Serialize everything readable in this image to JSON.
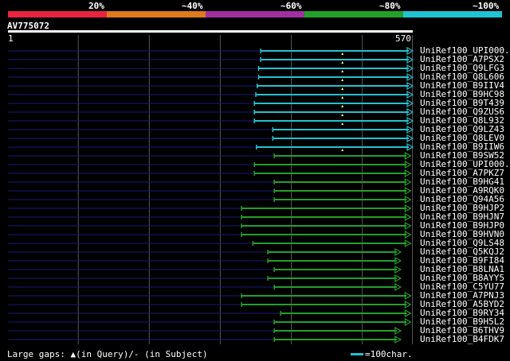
{
  "legend": {
    "segments": [
      {
        "label": "20%",
        "color": "#e8243e"
      },
      {
        "label": "~40%",
        "color": "#e07a1e"
      },
      {
        "label": "~60%",
        "color": "#a0309f"
      },
      {
        "label": "~80%",
        "color": "#23a02a"
      },
      {
        "label": "~100%",
        "color": "#22c3d1"
      }
    ]
  },
  "query": {
    "name": "AV775072",
    "start": "1",
    "end": "570",
    "length": 570
  },
  "hits": [
    {
      "label": "UniRef100_UPI000..",
      "start": 357,
      "end": 570,
      "color": "#22c3d1",
      "gap": true
    },
    {
      "label": "UniRef100_A7PSX2",
      "start": 357,
      "end": 570,
      "color": "#22c3d1",
      "gap": true
    },
    {
      "label": "UniRef100_Q9LFG3",
      "start": 354,
      "end": 570,
      "color": "#22c3d1",
      "gap": true
    },
    {
      "label": "UniRef100_Q8L606",
      "start": 354,
      "end": 570,
      "color": "#22c3d1",
      "gap": true
    },
    {
      "label": "UniRef100_B9IIV4",
      "start": 352,
      "end": 570,
      "color": "#22c3d1",
      "gap": true
    },
    {
      "label": "UniRef100_B9HC98",
      "start": 350,
      "end": 570,
      "color": "#22c3d1",
      "gap": true
    },
    {
      "label": "UniRef100_B9T439",
      "start": 348,
      "end": 570,
      "color": "#22c3d1",
      "gap": true
    },
    {
      "label": "UniRef100_Q9ZUS6",
      "start": 348,
      "end": 570,
      "color": "#22c3d1",
      "gap": true
    },
    {
      "label": "UniRef100_Q8L932",
      "start": 348,
      "end": 570,
      "color": "#22c3d1",
      "gap": true
    },
    {
      "label": "UniRef100_Q9LZ43",
      "start": 374,
      "end": 570,
      "color": "#22c3d1",
      "gap": false
    },
    {
      "label": "UniRef100_Q8LEV0",
      "start": 374,
      "end": 570,
      "color": "#22c3d1",
      "gap": false
    },
    {
      "label": "UniRef100_B9IIW6",
      "start": 351,
      "end": 570,
      "color": "#22c3d1",
      "gap": true
    },
    {
      "label": "UniRef100_B9SW52",
      "start": 376,
      "end": 567,
      "color": "#23a02a",
      "gap": false
    },
    {
      "label": "UniRef100_UPI000..",
      "start": 348,
      "end": 567,
      "color": "#23a02a",
      "gap": false
    },
    {
      "label": "UniRef100_A7PKZ7",
      "start": 348,
      "end": 567,
      "color": "#23a02a",
      "gap": false
    },
    {
      "label": "UniRef100_B9HG41",
      "start": 376,
      "end": 567,
      "color": "#23a02a",
      "gap": false
    },
    {
      "label": "UniRef100_A9RQK0",
      "start": 376,
      "end": 567,
      "color": "#23a02a",
      "gap": false
    },
    {
      "label": "UniRef100_Q94A56",
      "start": 376,
      "end": 567,
      "color": "#23a02a",
      "gap": false
    },
    {
      "label": "UniRef100_B9HJP2",
      "start": 330,
      "end": 567,
      "color": "#23a02a",
      "gap": false
    },
    {
      "label": "UniRef100_B9HJN7",
      "start": 330,
      "end": 567,
      "color": "#23a02a",
      "gap": false
    },
    {
      "label": "UniRef100_B9HJP0",
      "start": 330,
      "end": 567,
      "color": "#23a02a",
      "gap": false
    },
    {
      "label": "UniRef100_B9HVN0",
      "start": 330,
      "end": 567,
      "color": "#23a02a",
      "gap": false
    },
    {
      "label": "UniRef100_Q9LS48",
      "start": 346,
      "end": 567,
      "color": "#23a02a",
      "gap": false
    },
    {
      "label": "UniRef100_Q5KQJ2",
      "start": 367,
      "end": 553,
      "color": "#23a02a",
      "gap": false
    },
    {
      "label": "UniRef100_B9FI84",
      "start": 367,
      "end": 553,
      "color": "#23a02a",
      "gap": false
    },
    {
      "label": "UniRef100_B8LNA1",
      "start": 376,
      "end": 553,
      "color": "#23a02a",
      "gap": false
    },
    {
      "label": "UniRef100_B8AYY5",
      "start": 367,
      "end": 553,
      "color": "#23a02a",
      "gap": false
    },
    {
      "label": "UniRef100_C5YU77",
      "start": 376,
      "end": 553,
      "color": "#23a02a",
      "gap": false
    },
    {
      "label": "UniRef100_A7PNJ3",
      "start": 330,
      "end": 567,
      "color": "#23a02a",
      "gap": false
    },
    {
      "label": "UniRef100_A5BYD2",
      "start": 330,
      "end": 567,
      "color": "#23a02a",
      "gap": false
    },
    {
      "label": "UniRef100_B9RY34",
      "start": 385,
      "end": 567,
      "color": "#23a02a",
      "gap": false
    },
    {
      "label": "UniRef100_B9H5L2",
      "start": 376,
      "end": 567,
      "color": "#23a02a",
      "gap": false
    },
    {
      "label": "UniRef100_B6THV9",
      "start": 376,
      "end": 553,
      "color": "#23a02a",
      "gap": false
    },
    {
      "label": "UniRef100_B4FDK7",
      "start": 376,
      "end": 553,
      "color": "#23a02a",
      "gap": false
    }
  ],
  "footer": {
    "note": "Large gaps: ▲(in Query)/- (in Subject)",
    "scale": "=100char."
  },
  "colors": {
    "background": "#000000",
    "grid": "#555555",
    "baseline": "#1a1a7a",
    "query_bar": "#ffffff"
  }
}
